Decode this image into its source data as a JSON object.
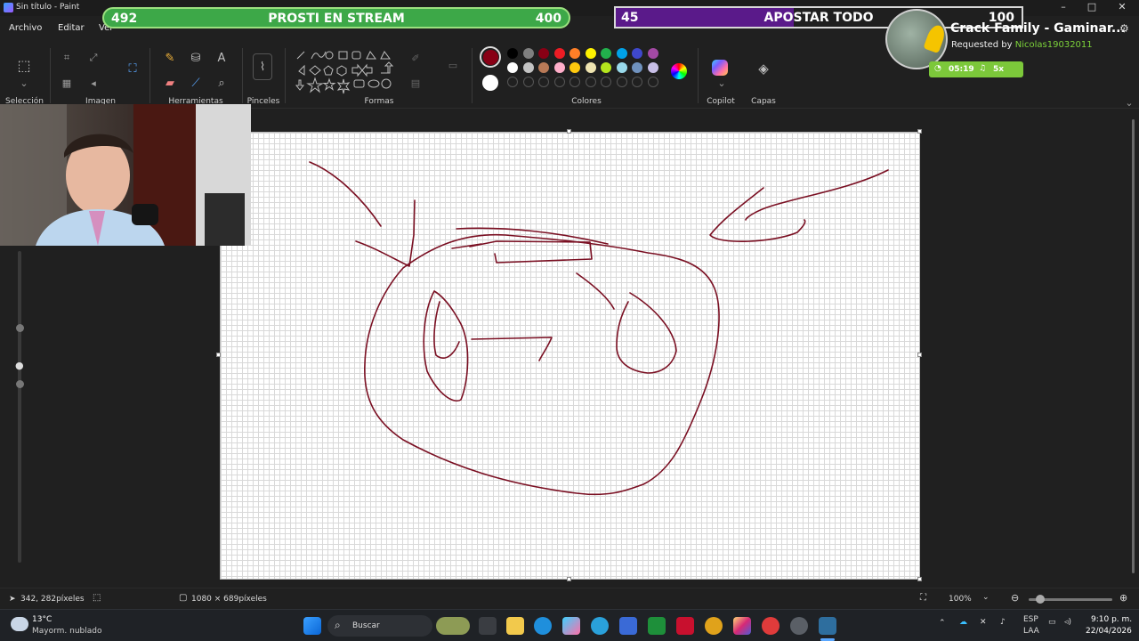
{
  "window": {
    "title": "Sin título - Paint",
    "minimize": "–",
    "maximize": "□",
    "close": "✕"
  },
  "menu": {
    "items": [
      "Archivo",
      "Editar",
      "Ver"
    ]
  },
  "ribbon": {
    "groups": {
      "seleccion": "Selección",
      "imagen": "Imagen",
      "herramientas": "Herramientas",
      "pinceles": "Pinceles",
      "formas": "Formas",
      "colores": "Colores",
      "copilot": "Copilot",
      "capas": "Capas"
    },
    "palette_row1": [
      "#000000",
      "#7f7f7f",
      "#880015",
      "#ed1c24",
      "#ff7f27",
      "#fff200",
      "#22b14c",
      "#00a2e8",
      "#3f48cc",
      "#a349a4"
    ],
    "palette_row2": [
      "#ffffff",
      "#c3c3c3",
      "#b97a57",
      "#ffaec9",
      "#ffc90e",
      "#efe4b0",
      "#b5e61d",
      "#99d9ea",
      "#7092be",
      "#c8bfe7"
    ],
    "color1": "#880015",
    "color2": "#ffffff"
  },
  "overlay": {
    "bar1": {
      "left_value": "492",
      "title": "PROSTI EN STREAM",
      "right_value": "400"
    },
    "bar2": {
      "left_value": "45",
      "title": "APOSTAR TODO",
      "right_value": "100"
    },
    "music": {
      "title": "Crack Family - Gaminar...",
      "requested_prefix": "Requested by ",
      "requested_user": "Nicolas19032011",
      "time": "05:19",
      "queue": "5x"
    }
  },
  "status": {
    "cursor_pos": "342, 282píxeles",
    "canvas_size": "1080 × 689píxeles",
    "zoom": "100%"
  },
  "taskbar": {
    "weather_temp": "13°C",
    "weather_desc": "Mayorm. nublado",
    "search_placeholder": "Buscar",
    "lang_line1": "ESP",
    "lang_line2": "LAA",
    "time": "9:10 p. m.",
    "date": "22/04/2026"
  },
  "colors": {
    "ink": "#7a0f22",
    "bar_green": "#3da848",
    "bar_purple": "#5a1a8a",
    "accent_green": "#7cc83a"
  }
}
